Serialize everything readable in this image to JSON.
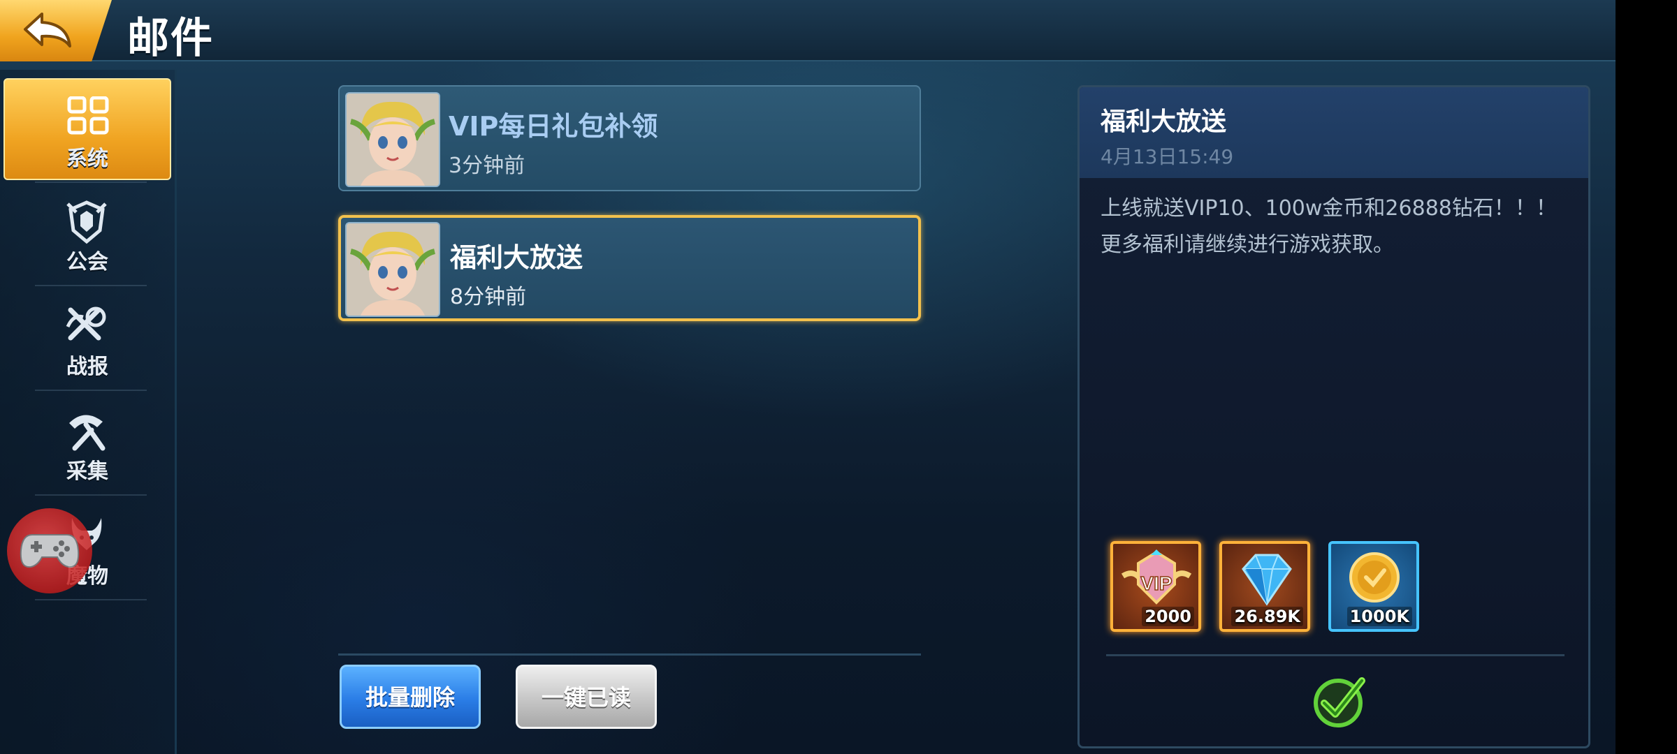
{
  "header": {
    "title": "邮件"
  },
  "sidebar": {
    "items": [
      {
        "label": "系统",
        "icon": "grid-icon",
        "active": true
      },
      {
        "label": "公会",
        "icon": "guild-shield-icon",
        "active": false
      },
      {
        "label": "战报",
        "icon": "battle-report-icon",
        "active": false
      },
      {
        "label": "采集",
        "icon": "pickaxe-icon",
        "active": false
      },
      {
        "label": "魔物",
        "icon": "monster-icon",
        "active": false
      }
    ]
  },
  "mails": [
    {
      "title": "VIP每日礼包补领",
      "time": "3分钟前",
      "selected": false,
      "title_color": "#a9cdf2"
    },
    {
      "title": "福利大放送",
      "time": "8分钟前",
      "selected": true,
      "title_color": "#ffffff"
    }
  ],
  "buttons": {
    "batch_delete": "批量删除",
    "mark_all_read": "一键已读"
  },
  "detail": {
    "title": "福利大放送",
    "date": "4月13日15:49",
    "body": "上线就送VIP10、100w金币和26888钻石！！！更多福利请继续进行游戏获取。",
    "rewards": [
      {
        "name": "vip-reward-icon",
        "qty": "2000"
      },
      {
        "name": "diamond-reward-icon",
        "qty": "26.89K"
      },
      {
        "name": "gold-coin-reward-icon",
        "qty": "1000K"
      }
    ]
  },
  "colors": {
    "accent": "#f0a422",
    "selected_border": "#f3c14d",
    "blue_button": "#2a7de6"
  }
}
